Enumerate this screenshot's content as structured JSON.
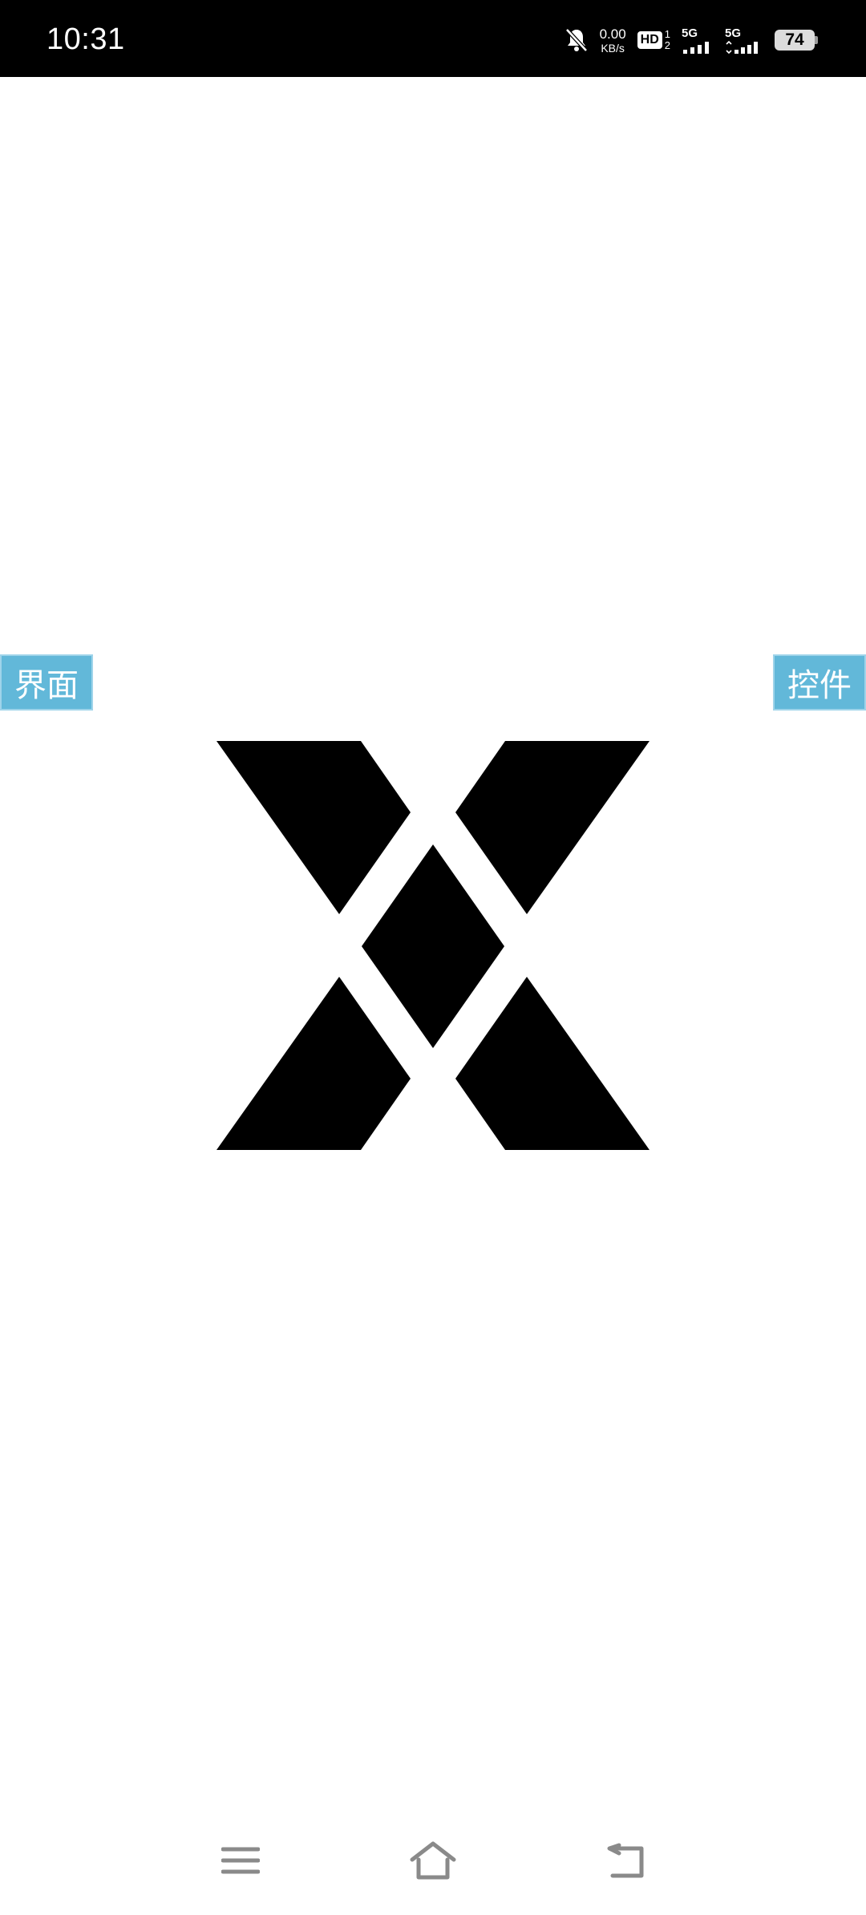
{
  "status_bar": {
    "time": "10:31",
    "net_speed_value": "0.00",
    "net_speed_unit": "KB/s",
    "hd_label": "HD",
    "hd_digit_top": "1",
    "hd_digit_bottom": "2",
    "signal_1_label": "5G",
    "signal_2_label": "5G",
    "battery_level": "74",
    "icons": [
      "bell-muted-icon",
      "hd-voice-icon",
      "signal-icon",
      "battery-icon"
    ]
  },
  "side_tabs": {
    "left_label": "界面",
    "right_label": "控件",
    "color": "#62b8d9"
  },
  "logo": {
    "icon": "x-logo-icon",
    "color": "#000000"
  },
  "nav_bar": {
    "icons": [
      "menu-icon",
      "home-icon",
      "back-icon"
    ],
    "color": "#8a8a8a"
  }
}
